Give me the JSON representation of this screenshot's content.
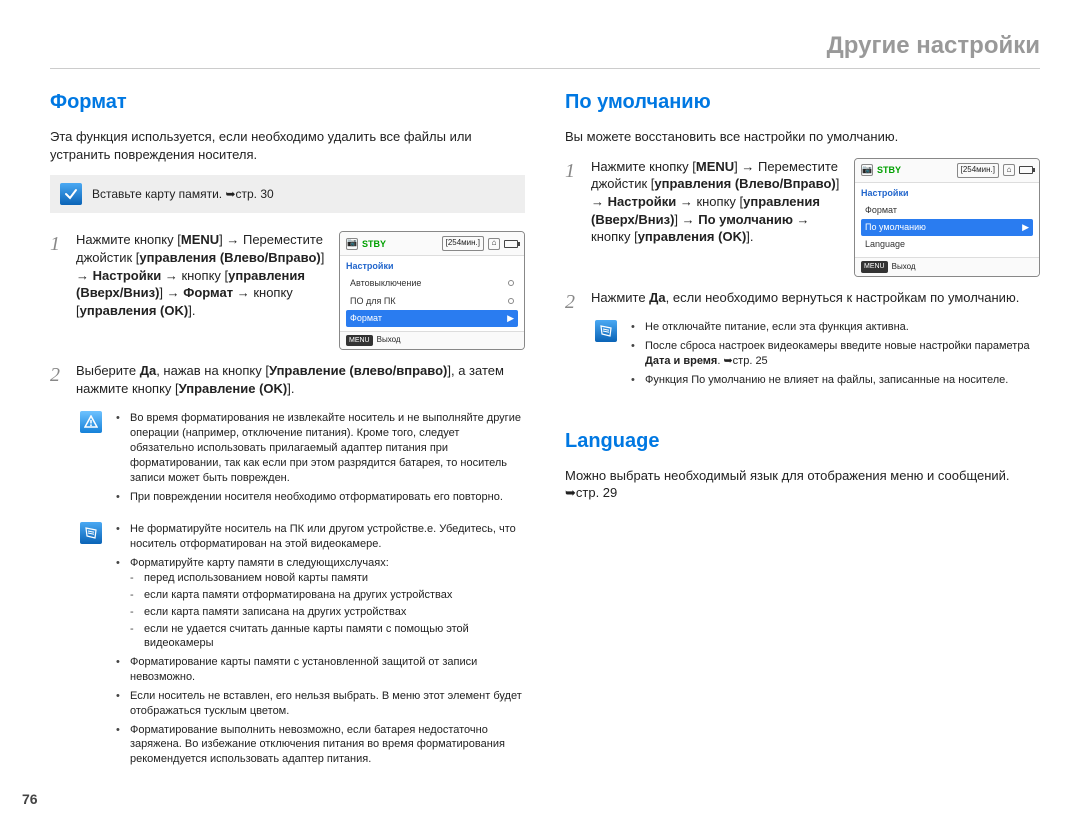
{
  "pageTitle": "Другие настройки",
  "pageNumber": "76",
  "left": {
    "heading": "Формат",
    "intro": "Эта функция используется, если необходимо удалить все файлы или устранить повреждения носителя.",
    "insertNote": "Вставьте карту памяти. ➥стр. 30",
    "steps": [
      "Нажмите кнопку [MENU] → Переместите джойстик [управления (Влево/Вправо)] → Настройки → кнопку [управления (Вверх/Вниз)] → Формат → кнопку [управления (OK)].",
      "Выберите Да, нажав на кнопку [Управление (влево/вправо)], а затем нажмите кнопку [Управление (OK)]."
    ],
    "display": {
      "stby": "STBY",
      "time": "[254мин.]",
      "menuTitle": "Настройки",
      "rows": [
        {
          "label": "Автовыключение",
          "selected": false,
          "hasDot": true
        },
        {
          "label": "ПО для ПК",
          "selected": false,
          "hasDot": true
        },
        {
          "label": "Формат",
          "selected": true,
          "hasChevron": true
        }
      ],
      "footerMenu": "MENU",
      "footerLabel": "Выход"
    },
    "warningNotes": [
      "Во время форматирования не извлекайте носитель и не выполняйте другие операции (например, отключение питания). Кроме того, следует обязательно использовать прилагаемый адаптер питания при форматировании, так как если при этом разрядится батарея, то носитель записи может быть поврежден.",
      "При повреждении носителя необходимо отформатировать его повторно."
    ],
    "infoNotes": [
      "Не форматируйте носитель на ПК или другом устройстве.е. Убедитесь, что носитель отформатирован на этой видеокамере.",
      "Форматируйте карту памяти в следующихслучаях:",
      "Форматирование карты памяти с установленной защитой от записи невозможно.",
      "Если носитель не вставлен, его нельзя выбрать. В меню этот элемент будет отображаться тусклым цветом.",
      "Форматирование выполнить невозможно, если батарея недостаточно заряжена. Во избежание отключения питания во время форматирования рекомендуется использовать адаптер питания."
    ],
    "infoSubNotes": [
      "перед использованием новой карты памяти",
      "если карта памяти отформатирована на других устройствах",
      "если карта памяти записана  на других устройствах",
      "если не удается считать данные карты памяти с помощью этой видеокамеры"
    ]
  },
  "mid": {
    "heading": "По умолчанию",
    "intro": "Вы можете восстановить все настройки по умолчанию.",
    "steps": [
      "Нажмите кнопку [MENU] → Переместите джойстик [управления (Влево/Вправо)] → Настройки → кнопку [управления (Вверх/Вниз)] → По умолчанию → кнопку [управления (OK)].",
      "Нажмите Да, если необходимо вернуться к настройкам по умолчанию."
    ],
    "display": {
      "stby": "STBY",
      "time": "[254мин.]",
      "menuTitle": "Настройки",
      "rows": [
        {
          "label": "Формат",
          "selected": false
        },
        {
          "label": "По умолчанию",
          "selected": true,
          "hasChevron": true
        },
        {
          "label": "Language",
          "selected": false
        }
      ],
      "footerMenu": "MENU",
      "footerLabel": "Выход"
    },
    "infoNotes": [
      "Не отключайте питание, если эта функция активна.",
      "После сброса настроек видеокамеры введите новые настройки параметра Дата и время. ➥стр. 25",
      "Функция По умолчанию не влияет на файлы, записанные на носителе."
    ]
  },
  "lang": {
    "heading": "Language",
    "intro": "Можно выбрать необходимый язык для отображения меню и сообщений. ➥стр. 29"
  }
}
